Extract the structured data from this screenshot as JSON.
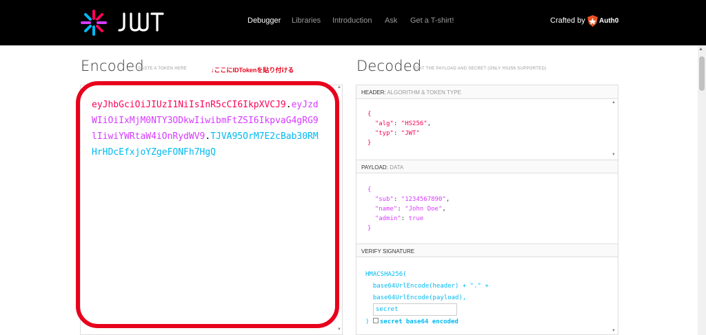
{
  "nav": {
    "logo_text": "JWT",
    "items": [
      "Debugger",
      "Libraries",
      "Introduction",
      "Ask",
      "Get a T-shirt!"
    ],
    "crafted_by": "Crafted by",
    "auth0": "Auth0"
  },
  "encoded": {
    "title": "Encoded",
    "subtitle": "PASTE A TOKEN HERE",
    "annotation": "↓ここにIDTokenを貼り付ける",
    "token_header": "eyJhbGciOiJIUzI1NiIsInR5cCI6IkpXVCJ9",
    "token_payload": "eyJzdWIiOiIxMjM0NTY3ODkwIiwibmFtZSI6IkpvaG4gRG9lIiwiYWRtaW4iOnRydWV9",
    "token_signature": "TJVA95OrM7E2cBab30RMHrHDcEfxjoYZgeFONFh7HgQ",
    "dot": "."
  },
  "decoded": {
    "title": "Decoded",
    "subtitle": "EDIT THE PAYLOAD AND SECRET (ONLY HS256 SUPPORTED)",
    "header_label": "HEADER:",
    "header_sub": "ALGORITHM & TOKEN TYPE",
    "header_json": {
      "open": "{",
      "alg_key": "\"alg\"",
      "alg_val": "\"HS256\"",
      "typ_key": "\"typ\"",
      "typ_val": "\"JWT\"",
      "close": "}"
    },
    "payload_label": "PAYLOAD:",
    "payload_sub": "DATA",
    "payload_json": {
      "open": "{",
      "sub_key": "\"sub\"",
      "sub_val": "\"1234567890\"",
      "name_key": "\"name\"",
      "name_val": "\"John Doe\"",
      "admin_key": "\"admin\"",
      "admin_val": "true",
      "close": "}"
    },
    "verify_label": "VERIFY SIGNATURE",
    "verify": {
      "line1": "HMACSHA256(",
      "line2": "base64UrlEncode(header) + \".\" +",
      "line3": "base64UrlEncode(payload),",
      "secret_value": "secret",
      "close": ")",
      "checkbox_label": "secret base64 encoded"
    }
  },
  "colors": {
    "header": "#fb015b",
    "payload": "#d63aff",
    "signature": "#00b9f1",
    "annotation": "#e8001c"
  }
}
